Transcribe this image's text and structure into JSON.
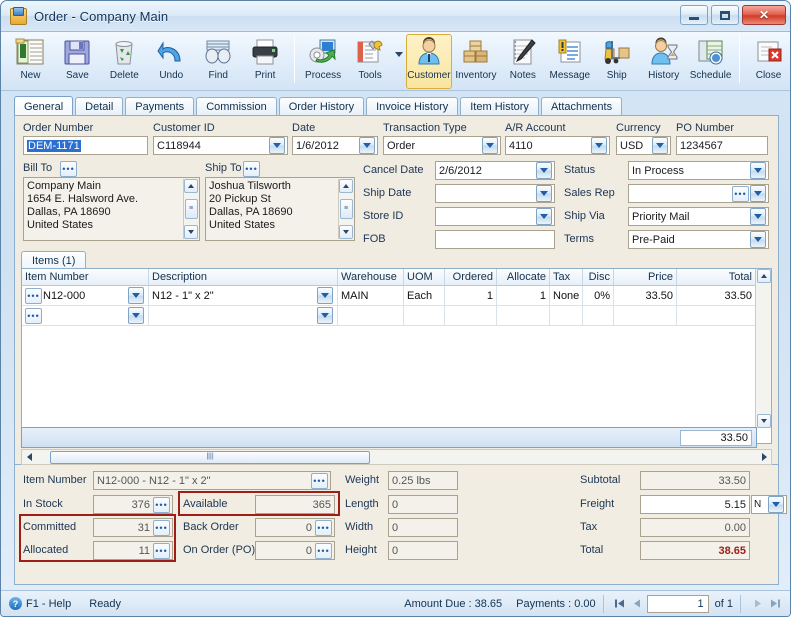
{
  "window": {
    "title": "Order - Company Main",
    "title_icon": "order-document-icon",
    "minimize_label": "Minimize",
    "maximize_label": "Maximize",
    "close_label": "✕"
  },
  "toolbar": {
    "buttons": [
      {
        "label": "New",
        "icon": "new-document-icon"
      },
      {
        "label": "Save",
        "icon": "floppy-disk-icon"
      },
      {
        "label": "Delete",
        "icon": "trash-can-icon"
      },
      {
        "label": "Undo",
        "icon": "undo-arrow-icon"
      },
      {
        "label": "Find",
        "icon": "binoculars-icon"
      },
      {
        "label": "Print",
        "icon": "printer-icon"
      },
      {
        "label": "Process",
        "icon": "gear-process-icon"
      },
      {
        "label": "Tools",
        "icon": "tools-icon"
      },
      {
        "label": "Customer",
        "icon": "customer-person-icon"
      },
      {
        "label": "Inventory",
        "icon": "boxes-icon"
      },
      {
        "label": "Notes",
        "icon": "notepad-pen-icon"
      },
      {
        "label": "Message",
        "icon": "message-icon"
      },
      {
        "label": "Ship",
        "icon": "forklift-icon"
      },
      {
        "label": "History",
        "icon": "person-hourglass-icon"
      },
      {
        "label": "Schedule",
        "icon": "schedule-calendar-icon"
      },
      {
        "label": "Close",
        "icon": "close-window-icon"
      }
    ],
    "active": "Customer"
  },
  "tabs": [
    {
      "label": "General",
      "selected": true
    },
    {
      "label": "Detail",
      "selected": false
    },
    {
      "label": "Payments",
      "selected": false
    },
    {
      "label": "Commission",
      "selected": false
    },
    {
      "label": "Order History",
      "selected": false
    },
    {
      "label": "Invoice History",
      "selected": false
    },
    {
      "label": "Item History",
      "selected": false
    },
    {
      "label": "Attachments",
      "selected": false
    }
  ],
  "header": {
    "order_number_label": "Order Number",
    "order_number_value": "DEM-1171",
    "customer_id_label": "Customer ID",
    "customer_id_value": "C118944",
    "date_label": "Date",
    "date_value": "1/6/2012",
    "transaction_type_label": "Transaction Type",
    "transaction_type_value": "Order",
    "ar_account_label": "A/R Account",
    "ar_account_value": "4110",
    "currency_label": "Currency",
    "currency_value": "USD",
    "po_number_label": "PO Number",
    "po_number_value": "1234567"
  },
  "bill_to": {
    "label": "Bill To",
    "lines": [
      "Company Main",
      "1654 E. Halsword Ave.",
      "Dallas, PA 18690",
      "United States"
    ]
  },
  "ship_to": {
    "label": "Ship To",
    "lines": [
      "Joshua Tilsworth",
      "20 Pickup St",
      "Dallas, PA 18690",
      "United States"
    ]
  },
  "dates": {
    "cancel_date_label": "Cancel  Date",
    "cancel_date_value": "2/6/2012",
    "ship_date_label": "Ship Date",
    "ship_date_value": "",
    "store_id_label": "Store ID",
    "store_id_value": "",
    "fob_label": "FOB",
    "fob_value": ""
  },
  "shipping": {
    "status_label": "Status",
    "status_value": "In Process",
    "sales_rep_label": "Sales Rep",
    "sales_rep_value": "",
    "ship_via_label": "Ship Via",
    "ship_via_value": "Priority Mail",
    "terms_label": "Terms",
    "terms_value": "Pre-Paid"
  },
  "items": {
    "tab_label": "Items (1)",
    "columns": [
      "Item Number",
      "Description",
      "Warehouse",
      "UOM",
      "Ordered",
      "Allocate",
      "Tax",
      "Disc",
      "Price",
      "Total"
    ],
    "rows": [
      {
        "item_number": "N12-000",
        "description": "N12 - 1\" x 2\"",
        "warehouse": "MAIN",
        "uom": "Each",
        "ordered": "1",
        "allocate": "1",
        "tax": "None",
        "disc": "0%",
        "price": "33.50",
        "total": "33.50"
      },
      {
        "item_number": "",
        "description": "",
        "warehouse": "",
        "uom": "",
        "ordered": "",
        "allocate": "",
        "tax": "",
        "disc": "",
        "price": "",
        "total": ""
      }
    ],
    "footer_total": "33.50"
  },
  "detail": {
    "item_number_label": "Item Number",
    "item_number_value": "N12-000 - N12 - 1\" x 2\"",
    "in_stock_label": "In Stock",
    "in_stock_value": "376",
    "committed_label": "Committed",
    "committed_value": "31",
    "allocated_label": "Allocated",
    "allocated_value": "11",
    "available_label": "Available",
    "available_value": "365",
    "back_order_label": "Back Order",
    "back_order_value": "0",
    "on_order_label": "On Order (PO)",
    "on_order_value": "0",
    "weight_label": "Weight",
    "weight_value": "0.25 lbs",
    "length_label": "Length",
    "length_value": "0",
    "width_label": "Width",
    "width_value": "0",
    "height_label": "Height",
    "height_value": "0",
    "highlight_color": "#a01c17"
  },
  "totals": {
    "subtotal_label": "Subtotal",
    "subtotal_value": "33.50",
    "freight_label": "Freight",
    "freight_value": "5.15",
    "freight_code": "N",
    "tax_label": "Tax",
    "tax_value": "0.00",
    "total_label": "Total",
    "total_value": "38.65",
    "total_color": "#9e1b16"
  },
  "statusbar": {
    "help_label": "F1 - Help",
    "status_text": "Ready",
    "amount_due_label": "Amount Due : 38.65",
    "payments_label": "Payments : 0.00",
    "page_value": "1",
    "page_of": "of 1",
    "first_icon": "first-record-icon",
    "prev_icon": "previous-record-icon",
    "next_icon": "next-record-icon",
    "last_icon": "last-record-icon"
  }
}
